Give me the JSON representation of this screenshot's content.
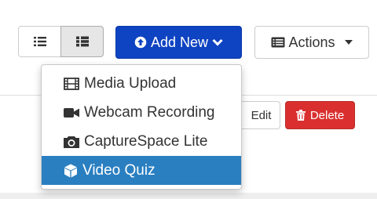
{
  "toolbar": {
    "add_new_label": "Add New",
    "actions_label": "Actions"
  },
  "row": {
    "edit_label": "Edit",
    "delete_label": "Delete"
  },
  "add_menu": {
    "items": [
      {
        "label": "Media Upload",
        "icon": "film-icon",
        "active": false
      },
      {
        "label": "Webcam Recording",
        "icon": "video-camera-icon",
        "active": false
      },
      {
        "label": "CaptureSpace Lite",
        "icon": "camera-icon",
        "active": false
      },
      {
        "label": "Video Quiz",
        "icon": "cube-icon",
        "active": true
      }
    ]
  },
  "colors": {
    "primary": "#0e43c1",
    "danger": "#d9302f",
    "menu_active": "#2a7fc1"
  }
}
